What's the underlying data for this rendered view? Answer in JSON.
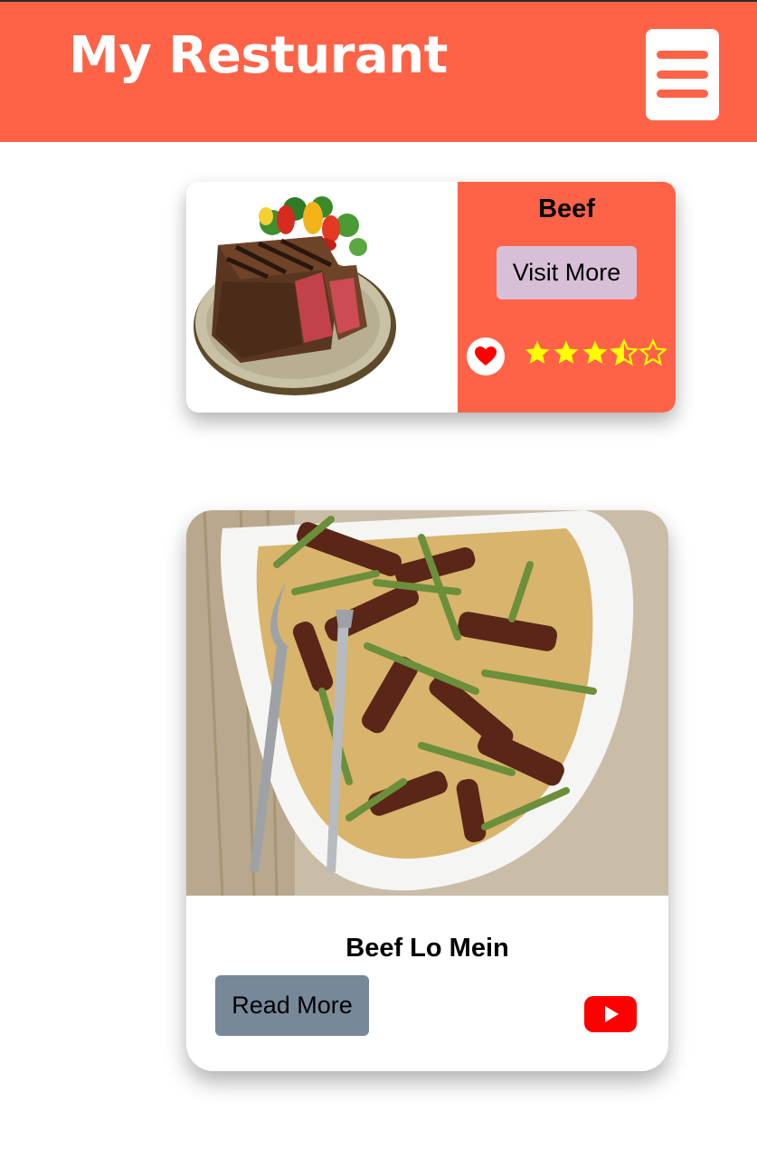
{
  "header": {
    "title": "My Resturant",
    "menu_icon": "hamburger-menu-icon"
  },
  "cards": [
    {
      "title": "Beef",
      "button_label": "Visit More",
      "image": "steak-plate-image",
      "favorite_icon": "heart-icon",
      "rating": 3.5,
      "rating_max": 5
    },
    {
      "title": "Beef Lo Mein",
      "button_label": "Read More",
      "image": "beef-lo-mein-image",
      "video_icon": "youtube-icon"
    }
  ],
  "colors": {
    "primary": "#FF6347",
    "visit_button": "#D8BFD8",
    "read_button": "#778899",
    "star": "#FFFF00",
    "heart": "#FF0000",
    "youtube": "#FF0000"
  }
}
